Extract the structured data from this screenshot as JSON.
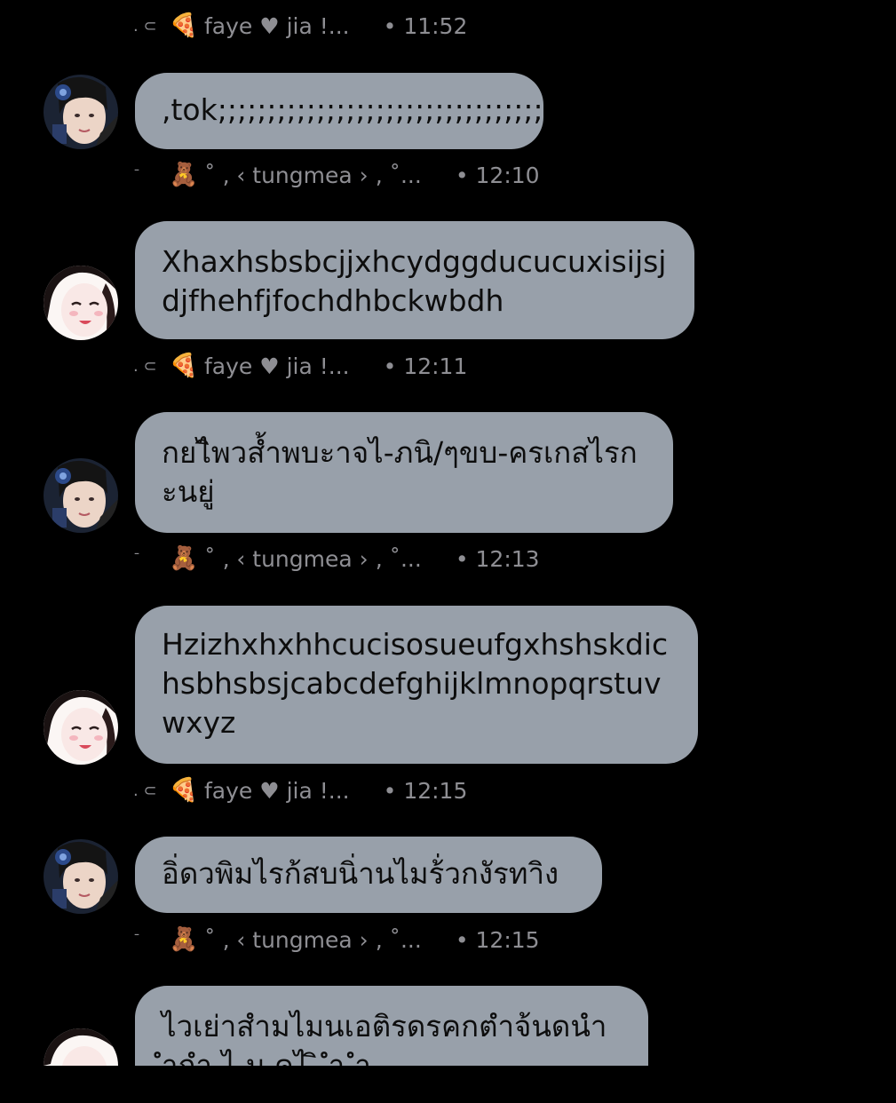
{
  "users": {
    "a": {
      "marker": ". ⊂",
      "emoji": "🍕",
      "name": "faye ♥ jia  !..."
    },
    "b": {
      "marker": "¯",
      "emoji": "🧸",
      "name": "˚ ‚ ‹ tungmea › ‚ ˚..."
    }
  },
  "messages": [
    {
      "sender": "a",
      "time": "• 11:52"
    },
    {
      "sender": "a",
      "text": ",tok;;;;;;;;;;;;;;;;;;;;;;;;;;;;;;;;;;;;",
      "time": ""
    },
    {
      "sender": "b",
      "time": "• 12:10"
    },
    {
      "sender": "b",
      "text": "Xhaxhsbsbcjjxhcydggducucuxisijsjdjfhehfjfochdhbckwbdh"
    },
    {
      "sender": "a",
      "time": "• 12:11"
    },
    {
      "sender": "a",
      "text": "กยไิพวส้ำพบะาจไ-ภนิ/ๆขบ-ครเกสไรกะนยู่"
    },
    {
      "sender": "b",
      "time": "• 12:13"
    },
    {
      "sender": "b",
      "text": "Hzizhxhxhhcucisosueufgxhshskdichsbhsbsjcabcdefghijklmnopqrstuvwxyz"
    },
    {
      "sender": "a",
      "time": "• 12:15"
    },
    {
      "sender": "a",
      "text": "อิ่ดวพิมไรก้สบนิ่านไมร้่วกงัรทาิง"
    },
    {
      "sender": "b",
      "time": "• 12:15"
    },
    {
      "sender": "b",
      "text": "ไวเย่าสำมไมนเอติรดรคกตำจ้นดนำ ำกำ ไ ม คไ ิ ำ ำ"
    }
  ]
}
